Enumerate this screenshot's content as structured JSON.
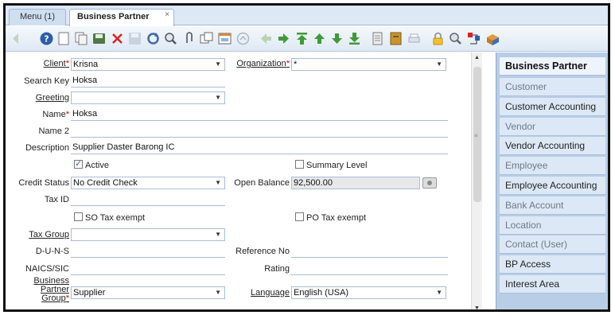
{
  "tabs": [
    {
      "label": "Menu (1)"
    },
    {
      "label": "Business Partner",
      "close": "×"
    }
  ],
  "form": {
    "client": {
      "label": "Client",
      "value": "Krisna"
    },
    "organization": {
      "label": "Organization",
      "value": "*"
    },
    "search_key": {
      "label": "Search Key",
      "value": "Hoksa"
    },
    "greeting": {
      "label": "Greeting",
      "value": ""
    },
    "name": {
      "label": "Name",
      "value": "Hoksa"
    },
    "name2": {
      "label": "Name 2",
      "value": ""
    },
    "description": {
      "label": "Description",
      "value": "Supplier Daster Barong IC"
    },
    "active": {
      "label": "Active",
      "checked": true
    },
    "summary_level": {
      "label": "Summary Level",
      "checked": false
    },
    "credit_status": {
      "label": "Credit Status",
      "value": "No Credit Check"
    },
    "open_balance": {
      "label": "Open Balance",
      "value": "92,500.00"
    },
    "tax_id": {
      "label": "Tax ID",
      "value": ""
    },
    "so_tax_exempt": {
      "label": "SO Tax exempt",
      "checked": false
    },
    "po_tax_exempt": {
      "label": "PO Tax exempt",
      "checked": false
    },
    "tax_group": {
      "label": "Tax Group",
      "value": ""
    },
    "duns": {
      "label": "D-U-N-S",
      "value": ""
    },
    "reference_no": {
      "label": "Reference No",
      "value": ""
    },
    "naics": {
      "label": "NAICS/SIC",
      "value": ""
    },
    "rating": {
      "label": "Rating",
      "value": ""
    },
    "bp_group": {
      "label_line1": "Business",
      "label_line2": "Partner",
      "label_line3": "Group",
      "value": "Supplier"
    },
    "language": {
      "label": "Language",
      "value": "English (USA)"
    }
  },
  "right_panel": {
    "items": [
      {
        "label": "Business Partner",
        "state": "active"
      },
      {
        "label": "Customer",
        "state": "muted"
      },
      {
        "label": "Customer Accounting",
        "state": "dark"
      },
      {
        "label": "Vendor",
        "state": "muted"
      },
      {
        "label": "Vendor Accounting",
        "state": "dark"
      },
      {
        "label": "Employee",
        "state": "muted"
      },
      {
        "label": "Employee Accounting",
        "state": "dark"
      },
      {
        "label": "Bank Account",
        "state": "muted"
      },
      {
        "label": "Location",
        "state": "muted"
      },
      {
        "label": "Contact (User)",
        "state": "muted"
      },
      {
        "label": "BP Access",
        "state": "dark"
      },
      {
        "label": "Interest Area",
        "state": "dark"
      }
    ]
  },
  "toolbar_icons": [
    "back-icon",
    "help-icon",
    "new-record-icon",
    "copy-record-icon",
    "save-new-icon",
    "delete-icon",
    "save-icon",
    "refresh-icon",
    "find-icon",
    "attachment-icon",
    "multi-view-icon",
    "history-icon",
    "home-icon",
    "previous-icon",
    "next-icon",
    "first-record-icon",
    "parent-record-icon",
    "detail-record-icon",
    "last-record-icon",
    "report-icon",
    "archive-icon",
    "print-icon",
    "lock-icon",
    "zoom-across-icon",
    "workflow-icon",
    "product-info-icon"
  ],
  "colors": {
    "required": "#dd0000",
    "accent": "#2a5db0",
    "panel": "#b8cde6"
  }
}
